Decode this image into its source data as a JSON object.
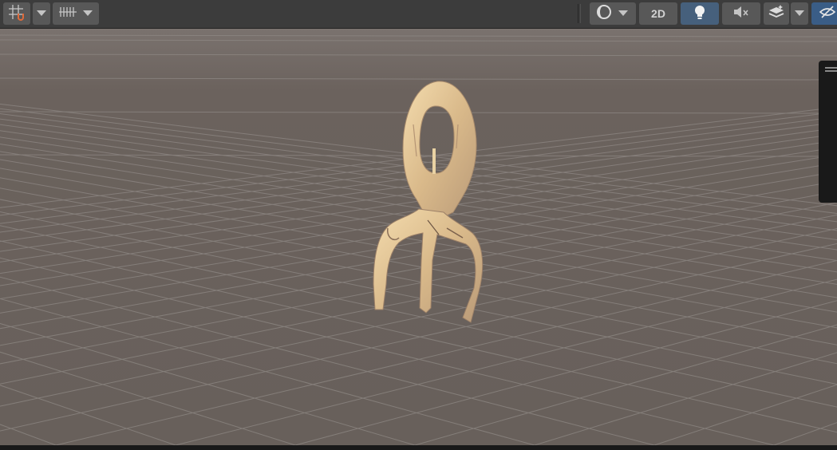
{
  "toolbar": {
    "left_buttons": [
      {
        "name": "grid-snap-icon"
      },
      {
        "name": "grid-snap-dropdown"
      },
      {
        "name": "increment-snap-icon"
      }
    ],
    "draw_mode_label": "",
    "mode_2d_label": "2D",
    "lighting_active": true,
    "audio_muted": true,
    "visibility_active": true
  },
  "viewport": {
    "background_color": "#6b625d",
    "grid_color": "#8f8a86",
    "object": "pitchfork-model"
  },
  "colors": {
    "toolbar": "#3c3c3c",
    "button": "#585858",
    "active_button": "#46607c",
    "panel": "#191919"
  }
}
